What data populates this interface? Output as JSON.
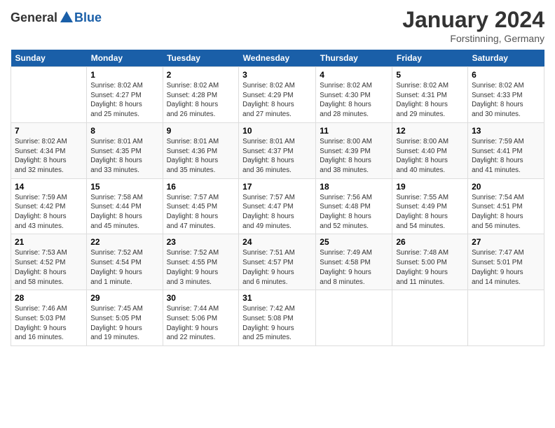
{
  "header": {
    "logo_general": "General",
    "logo_blue": "Blue",
    "title": "January 2024",
    "location": "Forstinning, Germany"
  },
  "weekdays": [
    "Sunday",
    "Monday",
    "Tuesday",
    "Wednesday",
    "Thursday",
    "Friday",
    "Saturday"
  ],
  "weeks": [
    [
      {
        "day": "",
        "info": ""
      },
      {
        "day": "1",
        "info": "Sunrise: 8:02 AM\nSunset: 4:27 PM\nDaylight: 8 hours\nand 25 minutes."
      },
      {
        "day": "2",
        "info": "Sunrise: 8:02 AM\nSunset: 4:28 PM\nDaylight: 8 hours\nand 26 minutes."
      },
      {
        "day": "3",
        "info": "Sunrise: 8:02 AM\nSunset: 4:29 PM\nDaylight: 8 hours\nand 27 minutes."
      },
      {
        "day": "4",
        "info": "Sunrise: 8:02 AM\nSunset: 4:30 PM\nDaylight: 8 hours\nand 28 minutes."
      },
      {
        "day": "5",
        "info": "Sunrise: 8:02 AM\nSunset: 4:31 PM\nDaylight: 8 hours\nand 29 minutes."
      },
      {
        "day": "6",
        "info": "Sunrise: 8:02 AM\nSunset: 4:33 PM\nDaylight: 8 hours\nand 30 minutes."
      }
    ],
    [
      {
        "day": "7",
        "info": "Sunrise: 8:02 AM\nSunset: 4:34 PM\nDaylight: 8 hours\nand 32 minutes."
      },
      {
        "day": "8",
        "info": "Sunrise: 8:01 AM\nSunset: 4:35 PM\nDaylight: 8 hours\nand 33 minutes."
      },
      {
        "day": "9",
        "info": "Sunrise: 8:01 AM\nSunset: 4:36 PM\nDaylight: 8 hours\nand 35 minutes."
      },
      {
        "day": "10",
        "info": "Sunrise: 8:01 AM\nSunset: 4:37 PM\nDaylight: 8 hours\nand 36 minutes."
      },
      {
        "day": "11",
        "info": "Sunrise: 8:00 AM\nSunset: 4:39 PM\nDaylight: 8 hours\nand 38 minutes."
      },
      {
        "day": "12",
        "info": "Sunrise: 8:00 AM\nSunset: 4:40 PM\nDaylight: 8 hours\nand 40 minutes."
      },
      {
        "day": "13",
        "info": "Sunrise: 7:59 AM\nSunset: 4:41 PM\nDaylight: 8 hours\nand 41 minutes."
      }
    ],
    [
      {
        "day": "14",
        "info": "Sunrise: 7:59 AM\nSunset: 4:42 PM\nDaylight: 8 hours\nand 43 minutes."
      },
      {
        "day": "15",
        "info": "Sunrise: 7:58 AM\nSunset: 4:44 PM\nDaylight: 8 hours\nand 45 minutes."
      },
      {
        "day": "16",
        "info": "Sunrise: 7:57 AM\nSunset: 4:45 PM\nDaylight: 8 hours\nand 47 minutes."
      },
      {
        "day": "17",
        "info": "Sunrise: 7:57 AM\nSunset: 4:47 PM\nDaylight: 8 hours\nand 49 minutes."
      },
      {
        "day": "18",
        "info": "Sunrise: 7:56 AM\nSunset: 4:48 PM\nDaylight: 8 hours\nand 52 minutes."
      },
      {
        "day": "19",
        "info": "Sunrise: 7:55 AM\nSunset: 4:49 PM\nDaylight: 8 hours\nand 54 minutes."
      },
      {
        "day": "20",
        "info": "Sunrise: 7:54 AM\nSunset: 4:51 PM\nDaylight: 8 hours\nand 56 minutes."
      }
    ],
    [
      {
        "day": "21",
        "info": "Sunrise: 7:53 AM\nSunset: 4:52 PM\nDaylight: 8 hours\nand 58 minutes."
      },
      {
        "day": "22",
        "info": "Sunrise: 7:52 AM\nSunset: 4:54 PM\nDaylight: 9 hours\nand 1 minute."
      },
      {
        "day": "23",
        "info": "Sunrise: 7:52 AM\nSunset: 4:55 PM\nDaylight: 9 hours\nand 3 minutes."
      },
      {
        "day": "24",
        "info": "Sunrise: 7:51 AM\nSunset: 4:57 PM\nDaylight: 9 hours\nand 6 minutes."
      },
      {
        "day": "25",
        "info": "Sunrise: 7:49 AM\nSunset: 4:58 PM\nDaylight: 9 hours\nand 8 minutes."
      },
      {
        "day": "26",
        "info": "Sunrise: 7:48 AM\nSunset: 5:00 PM\nDaylight: 9 hours\nand 11 minutes."
      },
      {
        "day": "27",
        "info": "Sunrise: 7:47 AM\nSunset: 5:01 PM\nDaylight: 9 hours\nand 14 minutes."
      }
    ],
    [
      {
        "day": "28",
        "info": "Sunrise: 7:46 AM\nSunset: 5:03 PM\nDaylight: 9 hours\nand 16 minutes."
      },
      {
        "day": "29",
        "info": "Sunrise: 7:45 AM\nSunset: 5:05 PM\nDaylight: 9 hours\nand 19 minutes."
      },
      {
        "day": "30",
        "info": "Sunrise: 7:44 AM\nSunset: 5:06 PM\nDaylight: 9 hours\nand 22 minutes."
      },
      {
        "day": "31",
        "info": "Sunrise: 7:42 AM\nSunset: 5:08 PM\nDaylight: 9 hours\nand 25 minutes."
      },
      {
        "day": "",
        "info": ""
      },
      {
        "day": "",
        "info": ""
      },
      {
        "day": "",
        "info": ""
      }
    ]
  ]
}
